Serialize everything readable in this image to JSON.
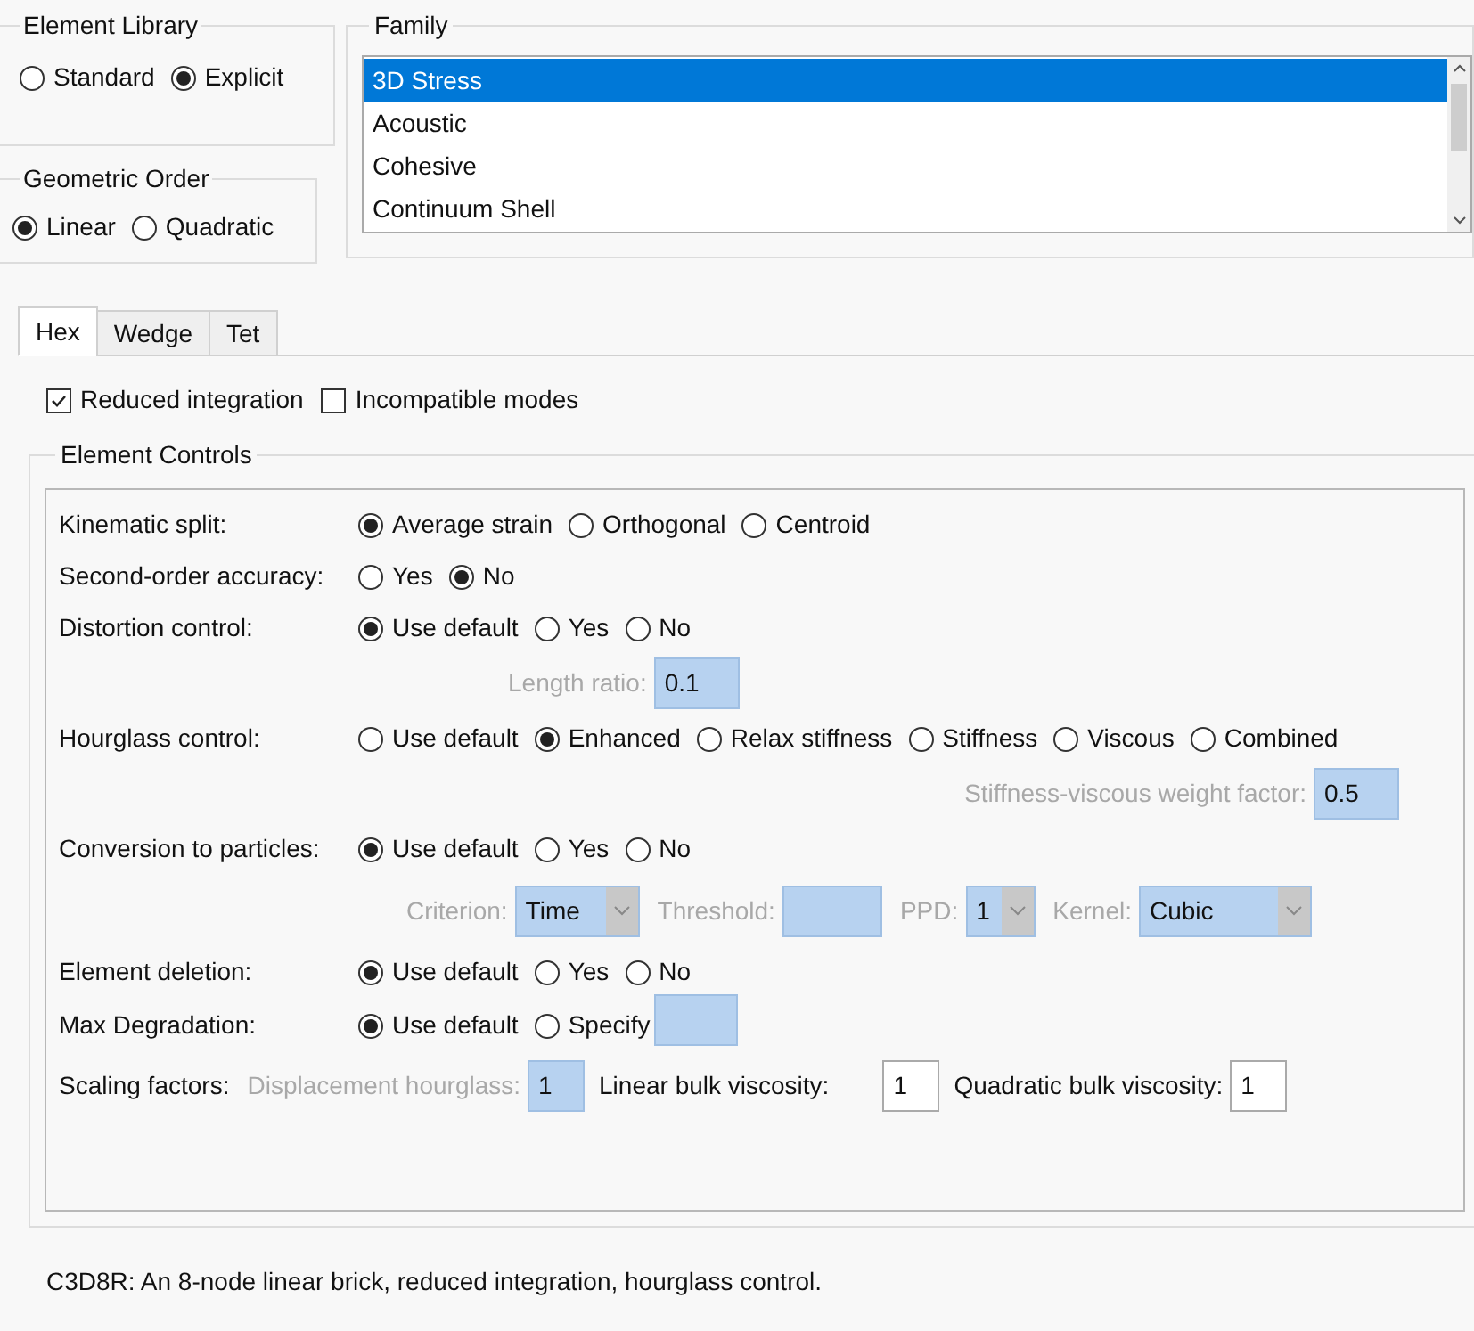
{
  "element_library": {
    "title": "Element Library",
    "options": [
      {
        "label": "Standard",
        "selected": false
      },
      {
        "label": "Explicit",
        "selected": true
      }
    ]
  },
  "geometric_order": {
    "title": "Geometric Order",
    "options": [
      {
        "label": "Linear",
        "selected": true
      },
      {
        "label": "Quadratic",
        "selected": false
      }
    ]
  },
  "family": {
    "title": "Family",
    "items": [
      {
        "label": "3D Stress",
        "selected": true
      },
      {
        "label": "Acoustic",
        "selected": false
      },
      {
        "label": "Cohesive",
        "selected": false
      },
      {
        "label": "Continuum Shell",
        "selected": false
      }
    ]
  },
  "tabs": [
    {
      "label": "Hex",
      "selected": true
    },
    {
      "label": "Wedge",
      "selected": false
    },
    {
      "label": "Tet",
      "selected": false
    }
  ],
  "checkboxes": [
    {
      "label": "Reduced integration",
      "checked": true
    },
    {
      "label": "Incompatible modes",
      "checked": false
    }
  ],
  "element_controls": {
    "title": "Element Controls",
    "rows": [
      {
        "kind": "radios",
        "label": "Kinematic split:",
        "options": [
          {
            "label": "Average strain",
            "selected": true
          },
          {
            "label": "Orthogonal",
            "selected": false
          },
          {
            "label": "Centroid",
            "selected": false
          }
        ]
      },
      {
        "kind": "radios",
        "label": "Second-order accuracy:",
        "options": [
          {
            "label": "Yes",
            "selected": false
          },
          {
            "label": "No",
            "selected": true
          }
        ]
      },
      {
        "kind": "radios",
        "label": "Distortion control:",
        "options": [
          {
            "label": "Use default",
            "selected": true
          },
          {
            "label": "Yes",
            "selected": false
          },
          {
            "label": "No",
            "selected": false
          }
        ]
      },
      {
        "kind": "field",
        "label": "Length ratio:",
        "value": "0.1"
      },
      {
        "kind": "radios",
        "label": "Hourglass control:",
        "options": [
          {
            "label": "Use default",
            "selected": false
          },
          {
            "label": "Enhanced",
            "selected": true
          },
          {
            "label": "Relax stiffness",
            "selected": false
          },
          {
            "label": "Stiffness",
            "selected": false
          },
          {
            "label": "Viscous",
            "selected": false
          },
          {
            "label": "Combined",
            "selected": false
          }
        ]
      },
      {
        "kind": "field_right",
        "label": "Stiffness-viscous weight factor:",
        "value": "0.5"
      },
      {
        "kind": "radios",
        "label": "Conversion to particles:",
        "options": [
          {
            "label": "Use default",
            "selected": true
          },
          {
            "label": "Yes",
            "selected": false
          },
          {
            "label": "No",
            "selected": false
          }
        ]
      },
      {
        "kind": "controls",
        "items": [
          {
            "kind": "select",
            "label": "Criterion:",
            "value": "Time"
          },
          {
            "kind": "field",
            "label": "Threshold:"
          },
          {
            "kind": "select",
            "label": "PPD:",
            "value": "1"
          },
          {
            "kind": "select",
            "label": "Kernel:",
            "value": "Cubic"
          }
        ]
      },
      {
        "kind": "radios",
        "label": "Element deletion:",
        "options": [
          {
            "label": "Use default",
            "selected": true
          },
          {
            "label": "Yes",
            "selected": false
          },
          {
            "label": "No",
            "selected": false
          }
        ]
      },
      {
        "kind": "radios_field",
        "label": "Max Degradation:",
        "options": [
          {
            "label": "Use default",
            "selected": true
          },
          {
            "label": "Specify",
            "selected": false
          }
        ]
      },
      {
        "kind": "scaling",
        "label": "Scaling factors:",
        "items": [
          {
            "label": "Displacement hourglass:",
            "value": "1",
            "disabled": true
          },
          {
            "label": "Linear bulk viscosity:",
            "value": "1",
            "disabled": false
          },
          {
            "label": "Quadratic bulk viscosity:",
            "value": "1",
            "disabled": false
          }
        ]
      }
    ]
  },
  "description": "C3D8R:  An 8-node linear brick, reduced integration, hourglass control."
}
